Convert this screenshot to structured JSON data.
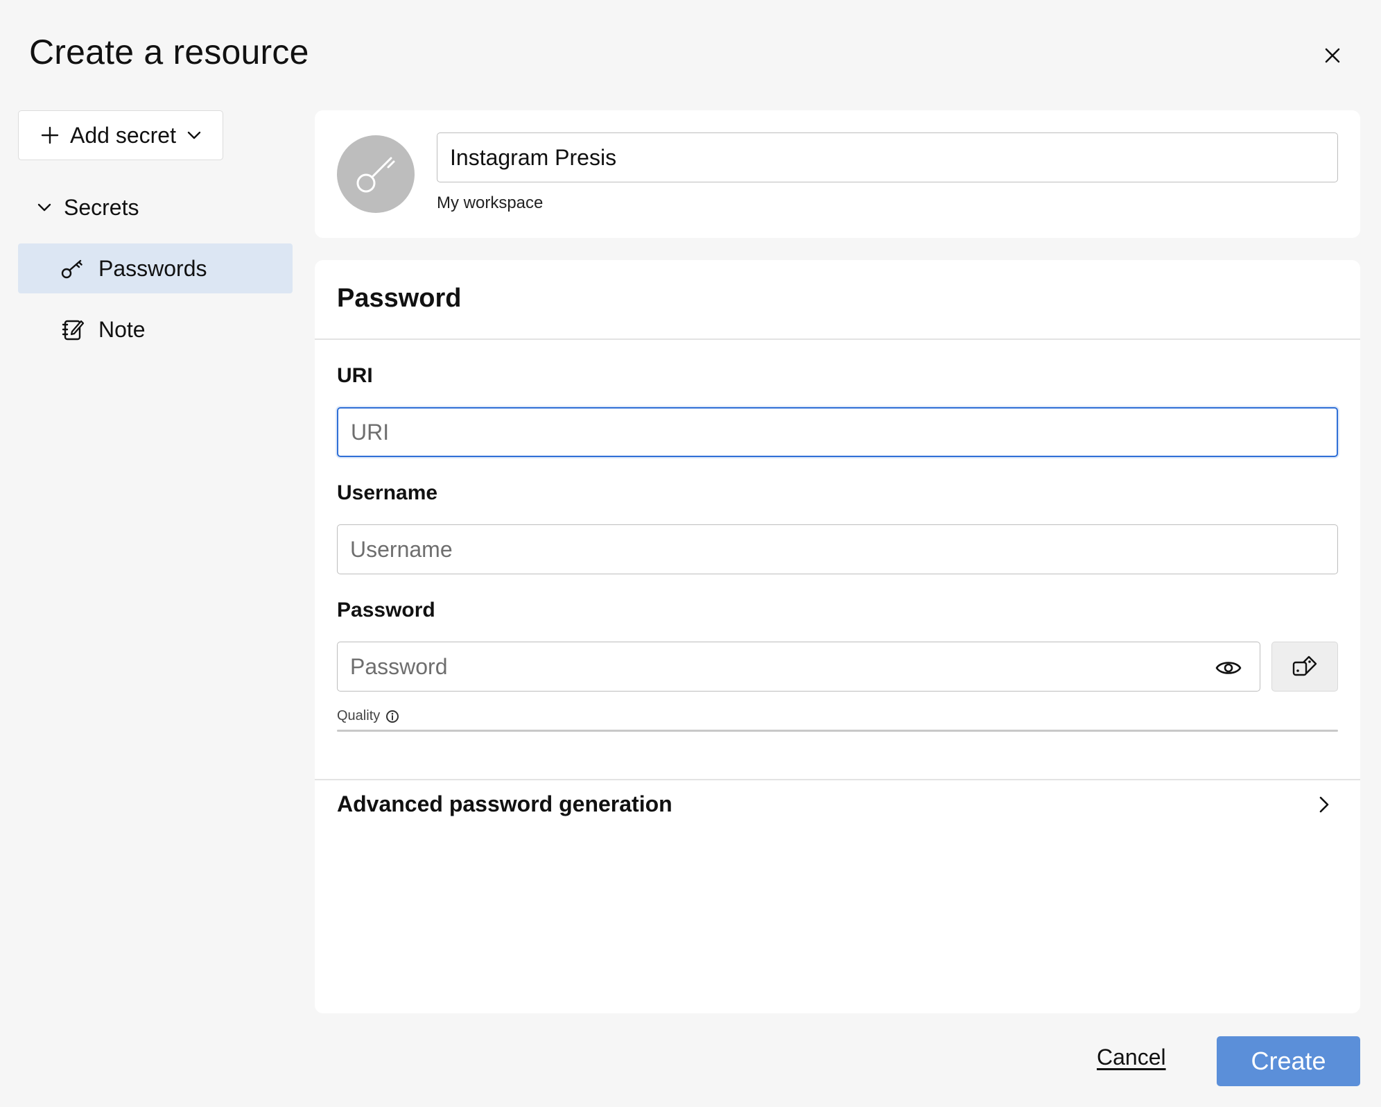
{
  "dialog": {
    "title": "Create a resource",
    "close_icon": "close-icon"
  },
  "sidebar": {
    "add_secret_label": "Add secret",
    "tree_label": "Secrets",
    "items": [
      {
        "label": "Passwords",
        "icon": "key-icon",
        "active": true
      },
      {
        "label": "Note",
        "icon": "note-icon",
        "active": false
      }
    ]
  },
  "header": {
    "name_value": "Instagram Presis",
    "workspace": "My workspace",
    "avatar_icon": "key-icon"
  },
  "password_section": {
    "title": "Password",
    "uri": {
      "label": "URI",
      "placeholder": "URI",
      "value": ""
    },
    "username": {
      "label": "Username",
      "placeholder": "Username",
      "value": ""
    },
    "password": {
      "label": "Password",
      "placeholder": "Password",
      "value": ""
    },
    "quality_label": "Quality",
    "advanced_label": "Advanced password generation"
  },
  "footer": {
    "cancel_label": "Cancel",
    "create_label": "Create"
  },
  "colors": {
    "accent": "#5b8fd9",
    "focus": "#2f6fd6",
    "active_item_bg": "#dce6f3"
  }
}
